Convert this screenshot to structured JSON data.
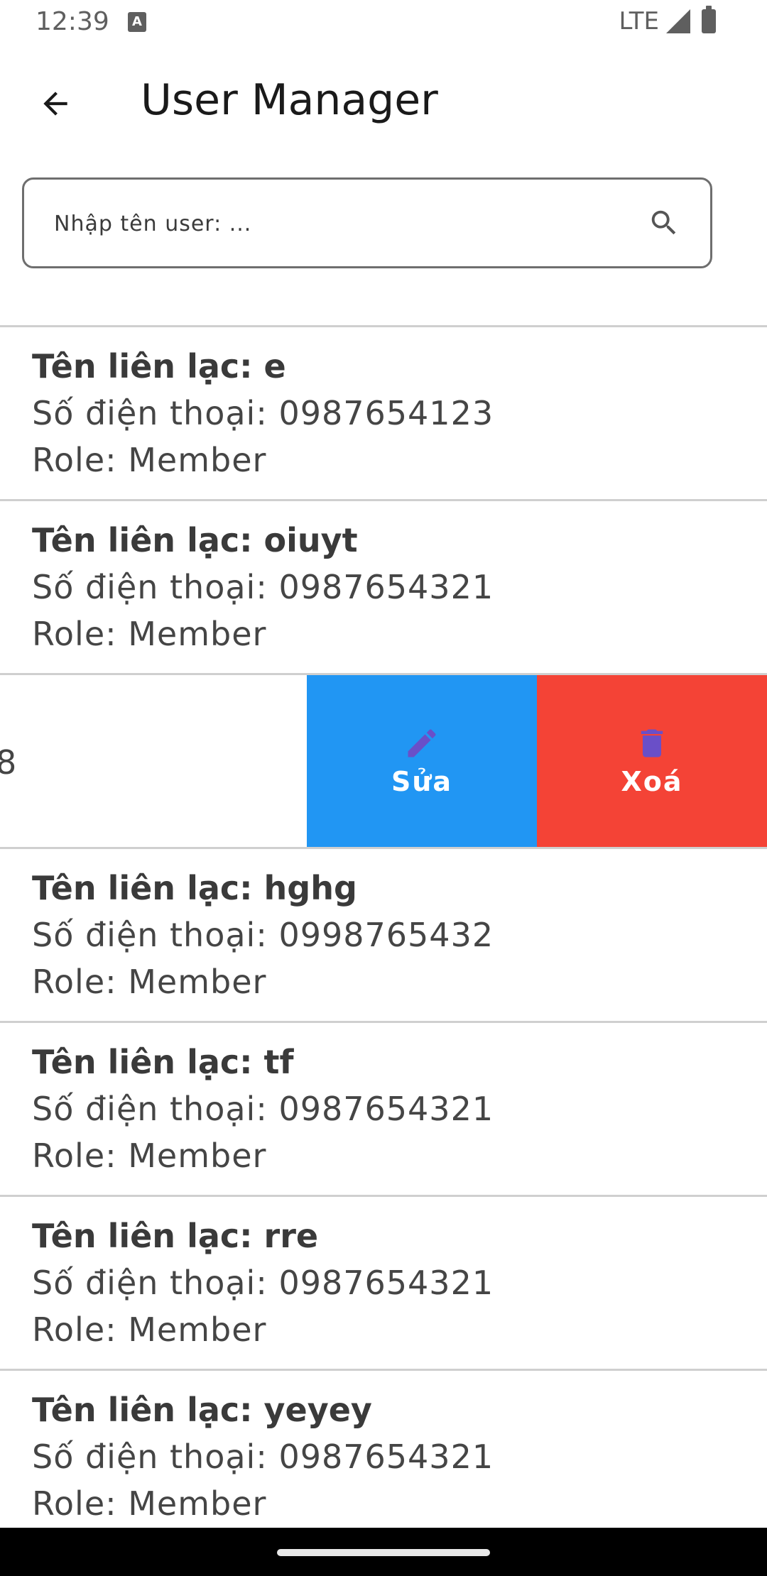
{
  "status_bar": {
    "time": "12:39",
    "notification_icon": "A",
    "network": "LTE"
  },
  "app_bar": {
    "title": "User Manager",
    "back_icon": "arrow-left-icon"
  },
  "search": {
    "placeholder": "Nhập tên user: ...",
    "icon": "search-icon"
  },
  "contacts": [
    {
      "name_line": "Tên liên lạc: e",
      "phone_line": "Số điện thoại: 0987654123",
      "role_line": "Role: Member"
    },
    {
      "name_line": "Tên liên lạc: oiuyt",
      "phone_line": "Số điện thoại: 0987654321",
      "role_line": "Role: Member"
    },
    {
      "swiped_visible_text": "8"
    },
    {
      "name_line": "Tên liên lạc: hghg",
      "phone_line": "Số điện thoại: 0998765432",
      "role_line": "Role: Member"
    },
    {
      "name_line": "Tên liên lạc: tf",
      "phone_line": "Số điện thoại: 0987654321",
      "role_line": "Role: Member"
    },
    {
      "name_line": "Tên liên lạc: rre",
      "phone_line": "Số điện thoại: 0987654321",
      "role_line": "Role: Member"
    },
    {
      "name_line": "Tên liên lạc: yeyey",
      "phone_line": "Số điện thoại: 0987654321",
      "role_line": "Role: Member"
    }
  ],
  "actions": {
    "edit_label": "Sửa",
    "delete_label": "Xoá",
    "edit_color": "#2196f3",
    "delete_color": "#f44336",
    "icon_color": "#6a4fc8"
  }
}
